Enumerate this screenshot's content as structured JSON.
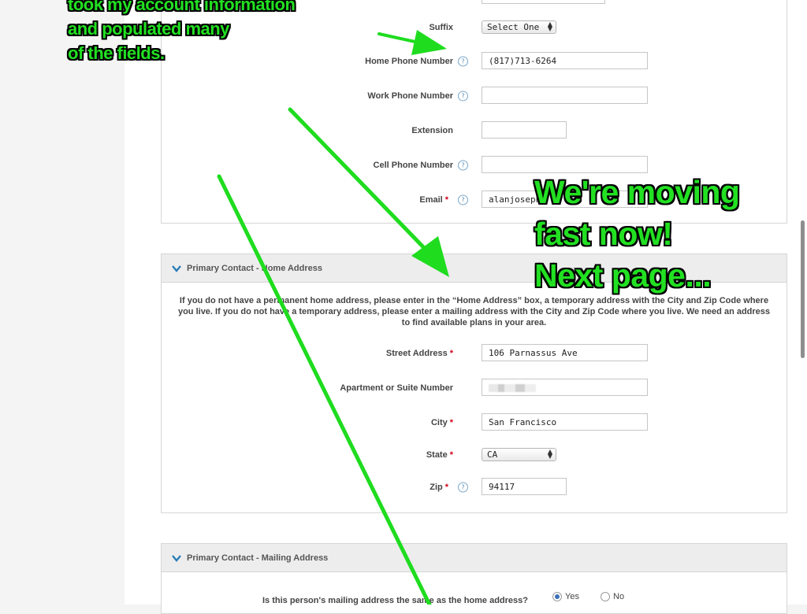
{
  "annotations": {
    "top_left": [
      "took my account information",
      "and populated many",
      "of the fields."
    ],
    "right": [
      "We're moving",
      "fast now!",
      "Next page..."
    ]
  },
  "account": {
    "suffix": {
      "label": "Suffix",
      "selected": "Select One"
    },
    "home_phone": {
      "label": "Home Phone Number",
      "value": "(817)713-6264"
    },
    "work_phone": {
      "label": "Work Phone Number",
      "value": ""
    },
    "extension": {
      "label": "Extension",
      "value": ""
    },
    "cell_phone": {
      "label": "Cell Phone Number",
      "value": ""
    },
    "email": {
      "label": "Email",
      "value": "alanjosephw"
    }
  },
  "required_mark": "*",
  "help_glyph": "?",
  "home_address": {
    "header": "Primary Contact - Home Address",
    "note": "If you do not have a permanent home address, please enter in the “Home Address” box, a temporary address with the City and Zip Code where you live. If you do not have a temporary address, please enter a mailing address with the City and Zip Code where you live. We need an address to find available plans in your area.",
    "street": {
      "label": "Street Address",
      "value": "106 Parnassus Ave"
    },
    "apt": {
      "label": "Apartment or Suite Number",
      "value": ""
    },
    "city": {
      "label": "City",
      "value": "San Francisco"
    },
    "state": {
      "label": "State",
      "selected": "CA"
    },
    "zip": {
      "label": "Zip",
      "value": "94117"
    }
  },
  "mailing_address": {
    "header": "Primary Contact - Mailing Address",
    "question": "Is this person's mailing address the same as the home address?",
    "yes_label": "Yes",
    "no_label": "No",
    "selected": "Yes"
  },
  "colors": {
    "annotation_green": "#22e022",
    "arrow_green": "#1fdc1f",
    "required_red": "#d0021b"
  }
}
